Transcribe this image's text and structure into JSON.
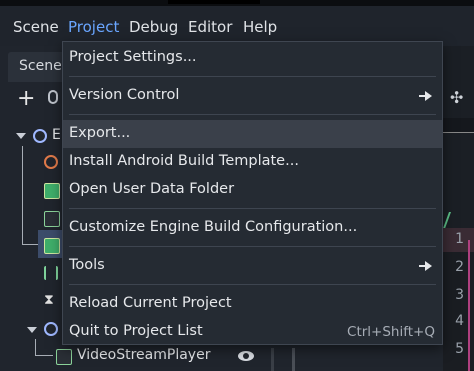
{
  "menubar": {
    "items": [
      "Scene",
      "Project",
      "Debug",
      "Editor",
      "Help"
    ],
    "active": "Project"
  },
  "scene_dock": {
    "tab_label": "Scene",
    "root_initial": "E",
    "nodes": [
      {
        "label": "VideoStreamPlayer",
        "icon": "video-stream-player-icon"
      }
    ]
  },
  "project_menu": {
    "items": [
      {
        "label": "Project Settings...",
        "shortcut": "",
        "submenu": false
      },
      {
        "label": "Version Control",
        "shortcut": "",
        "submenu": true
      },
      {
        "label": "Export...",
        "shortcut": "",
        "submenu": false
      },
      {
        "label": "Install Android Build Template...",
        "shortcut": "",
        "submenu": false
      },
      {
        "label": "Open User Data Folder",
        "shortcut": "",
        "submenu": false
      },
      {
        "label": "Customize Engine Build Configuration...",
        "shortcut": "",
        "submenu": false
      },
      {
        "label": "Tools",
        "shortcut": "",
        "submenu": true
      },
      {
        "label": "Reload Current Project",
        "shortcut": "",
        "submenu": false
      },
      {
        "label": "Quit to Project List",
        "shortcut": "Ctrl+Shift+Q",
        "submenu": false
      }
    ],
    "hovered": "Export..."
  },
  "editor_gutter": {
    "line_numbers": [
      "1",
      "2",
      "3",
      "4",
      "5"
    ]
  },
  "colors": {
    "accent": "#6aa6ff",
    "menu_bg": "#252b33",
    "hover_bg": "#3a404a",
    "selection": "#3c4c6a"
  }
}
